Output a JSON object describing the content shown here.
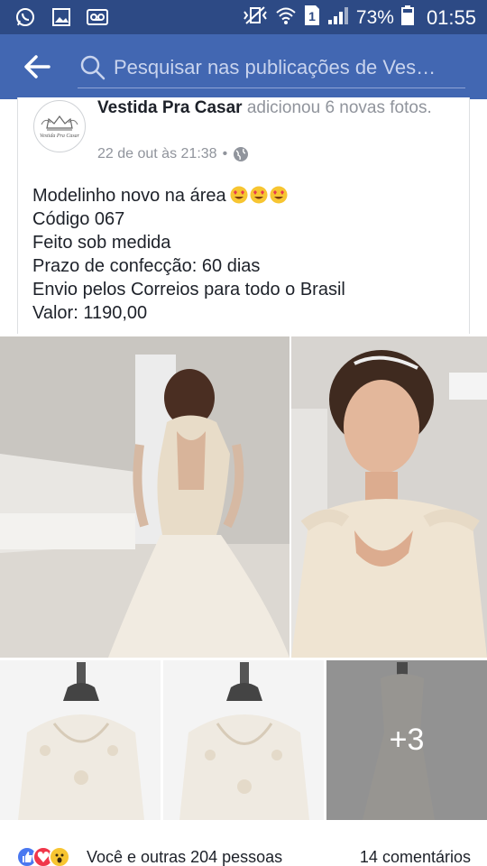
{
  "status_bar": {
    "battery": "73%",
    "time": "01:55",
    "sim_badge": "1",
    "icons": [
      "whatsapp-icon",
      "gallery-icon",
      "voicemail-icon",
      "mute-vibrate-icon",
      "wifi-icon",
      "sim-icon",
      "signal-icon",
      "battery-icon"
    ]
  },
  "header": {
    "search_placeholder": "Pesquisar nas publicações de Ves…",
    "bg_color": "#4267b2"
  },
  "post": {
    "avatar_text": "Vestida Pra Casar",
    "page_name": "Vestida Pra Casar",
    "action": "adicionou 6 novas fotos.",
    "timestamp": "22 de out às 21:38",
    "separator": "•",
    "lines": [
      "Modelinho novo na área",
      "Código 067",
      "Feito sob medida",
      "Prazo de confecção: 60 dias",
      "Envio pelos Correios para todo o Brasil",
      "Valor: 1190,00"
    ]
  },
  "photos": {
    "more_count": "+3"
  },
  "footer": {
    "reactions_text": "Você e outras 204 pessoas",
    "comments_text": "14 comentários"
  }
}
